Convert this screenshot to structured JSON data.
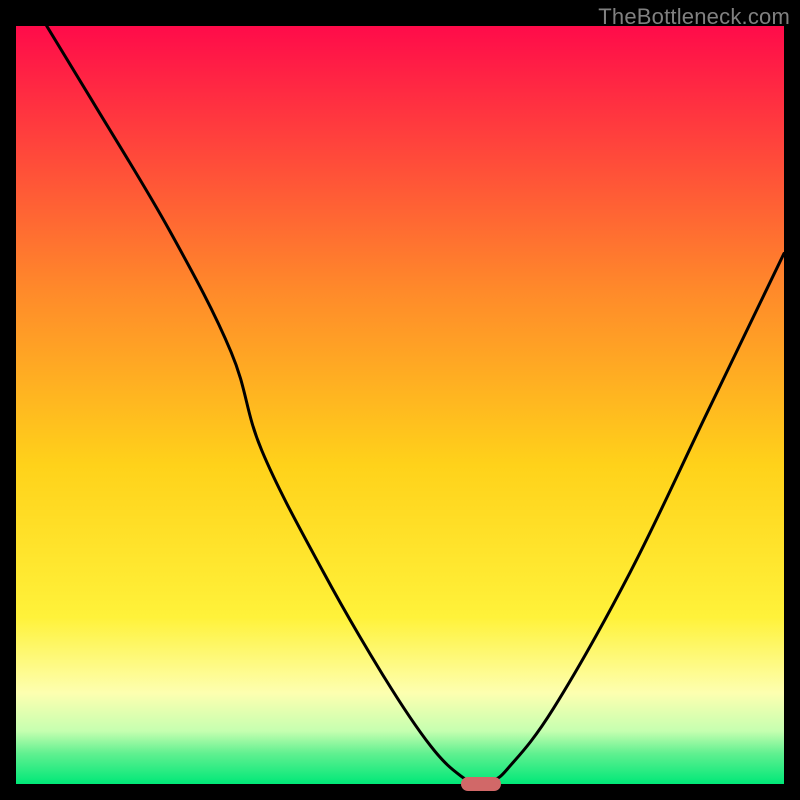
{
  "watermark": "TheBottleneck.com",
  "chart_data": {
    "type": "line",
    "title": "",
    "xlabel": "",
    "ylabel": "",
    "xlim": [
      0,
      100
    ],
    "ylim": [
      0,
      100
    ],
    "gradient_stops": [
      {
        "offset": 0,
        "color": "#ff0b4a"
      },
      {
        "offset": 35,
        "color": "#ff8a2a"
      },
      {
        "offset": 58,
        "color": "#ffd21a"
      },
      {
        "offset": 78,
        "color": "#fff23a"
      },
      {
        "offset": 88,
        "color": "#fdffb0"
      },
      {
        "offset": 93,
        "color": "#c6ffb0"
      },
      {
        "offset": 96,
        "color": "#60f090"
      },
      {
        "offset": 100,
        "color": "#00e878"
      }
    ],
    "series": [
      {
        "name": "bottleneck-curve",
        "color": "#000000",
        "x": [
          4,
          10,
          20,
          28,
          32,
          40,
          48,
          54,
          58,
          60.5,
          62,
          64,
          70,
          80,
          90,
          100
        ],
        "y": [
          100,
          90,
          73,
          57,
          44,
          28,
          14,
          5,
          1,
          0,
          0.5,
          2,
          10,
          28,
          49,
          70
        ]
      }
    ],
    "marker": {
      "x": 60.5,
      "y": 0,
      "color": "#d16868"
    }
  }
}
